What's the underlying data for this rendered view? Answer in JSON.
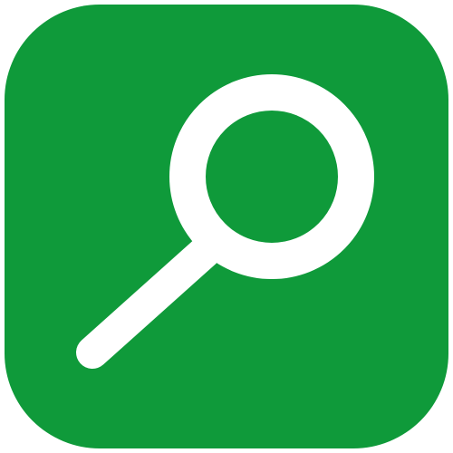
{
  "app_icon": {
    "icon": "search-icon",
    "glyph": "magnifying-glass",
    "colors": {
      "tile": "#0f9a3a",
      "glyph": "#ffffff",
      "background": "#ffffff"
    }
  }
}
